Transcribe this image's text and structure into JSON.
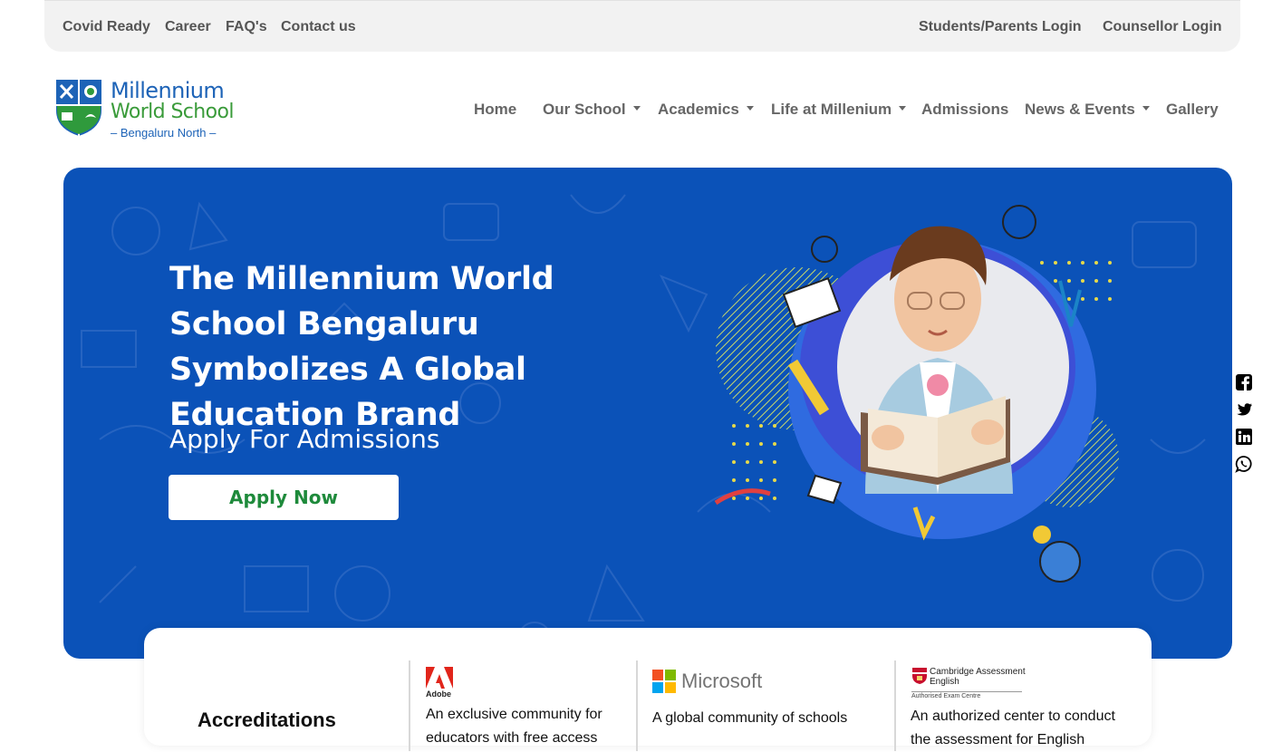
{
  "topbar": {
    "left_links": [
      "Covid Ready",
      "Career",
      "FAQ's",
      "Contact us"
    ],
    "right_links": [
      "Students/Parents Login",
      "Counsellor Login"
    ]
  },
  "logo": {
    "line1": "Millennium",
    "line2": "World School",
    "line3": "– Bengaluru North –"
  },
  "nav": {
    "items": [
      {
        "label": "Home",
        "dropdown": false
      },
      {
        "label": "Our School",
        "dropdown": true
      },
      {
        "label": "Academics",
        "dropdown": true
      },
      {
        "label": "Life at Millenium",
        "dropdown": true
      },
      {
        "label": "Admissions",
        "dropdown": false
      },
      {
        "label": "News & Events",
        "dropdown": true
      },
      {
        "label": "Gallery",
        "dropdown": false
      }
    ]
  },
  "hero": {
    "title": "The Millennium World School Bengaluru Symbolizes A Global Education Brand",
    "subtitle": "Apply For Admissions",
    "cta": "Apply Now"
  },
  "social": [
    "facebook-icon",
    "twitter-icon",
    "linkedin-icon",
    "whatsapp-icon"
  ],
  "accreditations": {
    "heading": "Accreditations",
    "items": [
      {
        "name": "Adobe",
        "desc": "An exclusive community for educators with free access"
      },
      {
        "name": "Microsoft",
        "desc": "A global community of schools"
      },
      {
        "name": "Cambridge Assessment English",
        "sub": "Authorised Exam Centre",
        "desc": "An authorized center to conduct the assessment for English"
      }
    ]
  },
  "colors": {
    "hero_blue": "#0b52b8",
    "brand_blue": "#1d63b7",
    "brand_green": "#3a9b3a",
    "cta_green": "#1e8a3b"
  }
}
